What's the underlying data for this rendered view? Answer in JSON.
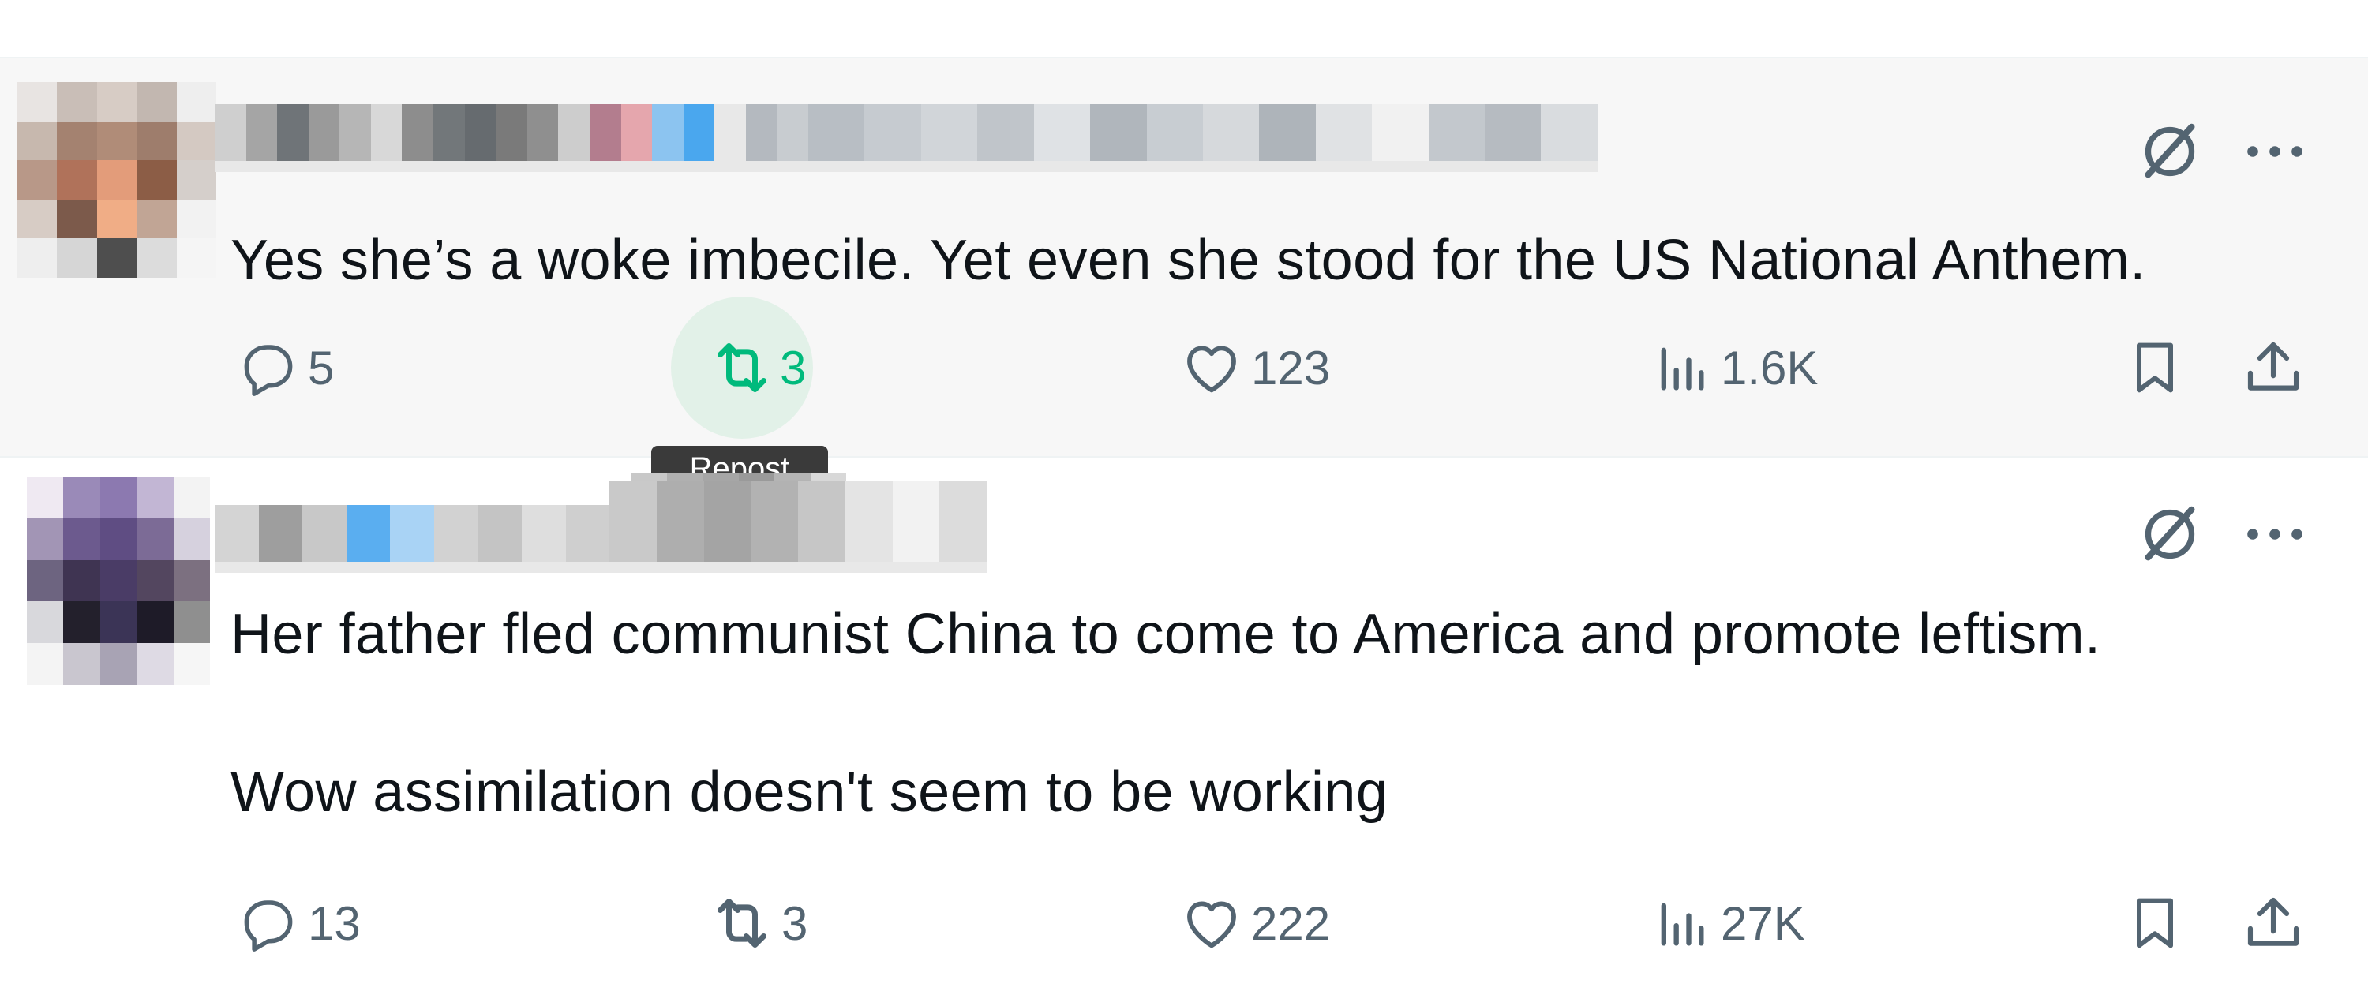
{
  "posts": [
    {
      "text": "Yes she’s a woke imbecile. Yet even she stood for the US National Anthem.",
      "actions": {
        "replies": "5",
        "reposts": "3",
        "likes": "123",
        "views": "1.6K"
      },
      "repost_active": true
    },
    {
      "text": "Her father fled communist China to come to America and promote leftism.\n\nWow assimilation doesn't seem to be working",
      "actions": {
        "replies": "13",
        "reposts": "3",
        "likes": "222",
        "views": "27K"
      },
      "repost_active": false
    }
  ],
  "tooltip": {
    "label": "Repost"
  },
  "colors": {
    "text": "#0f1419",
    "muted": "#536471",
    "repost_active": "#00ba7c",
    "hover_bg": "#f7f7f7"
  },
  "icons": [
    "grok-icon",
    "more-icon",
    "reply-icon",
    "repost-icon",
    "like-icon",
    "views-icon",
    "bookmark-icon",
    "share-icon"
  ]
}
